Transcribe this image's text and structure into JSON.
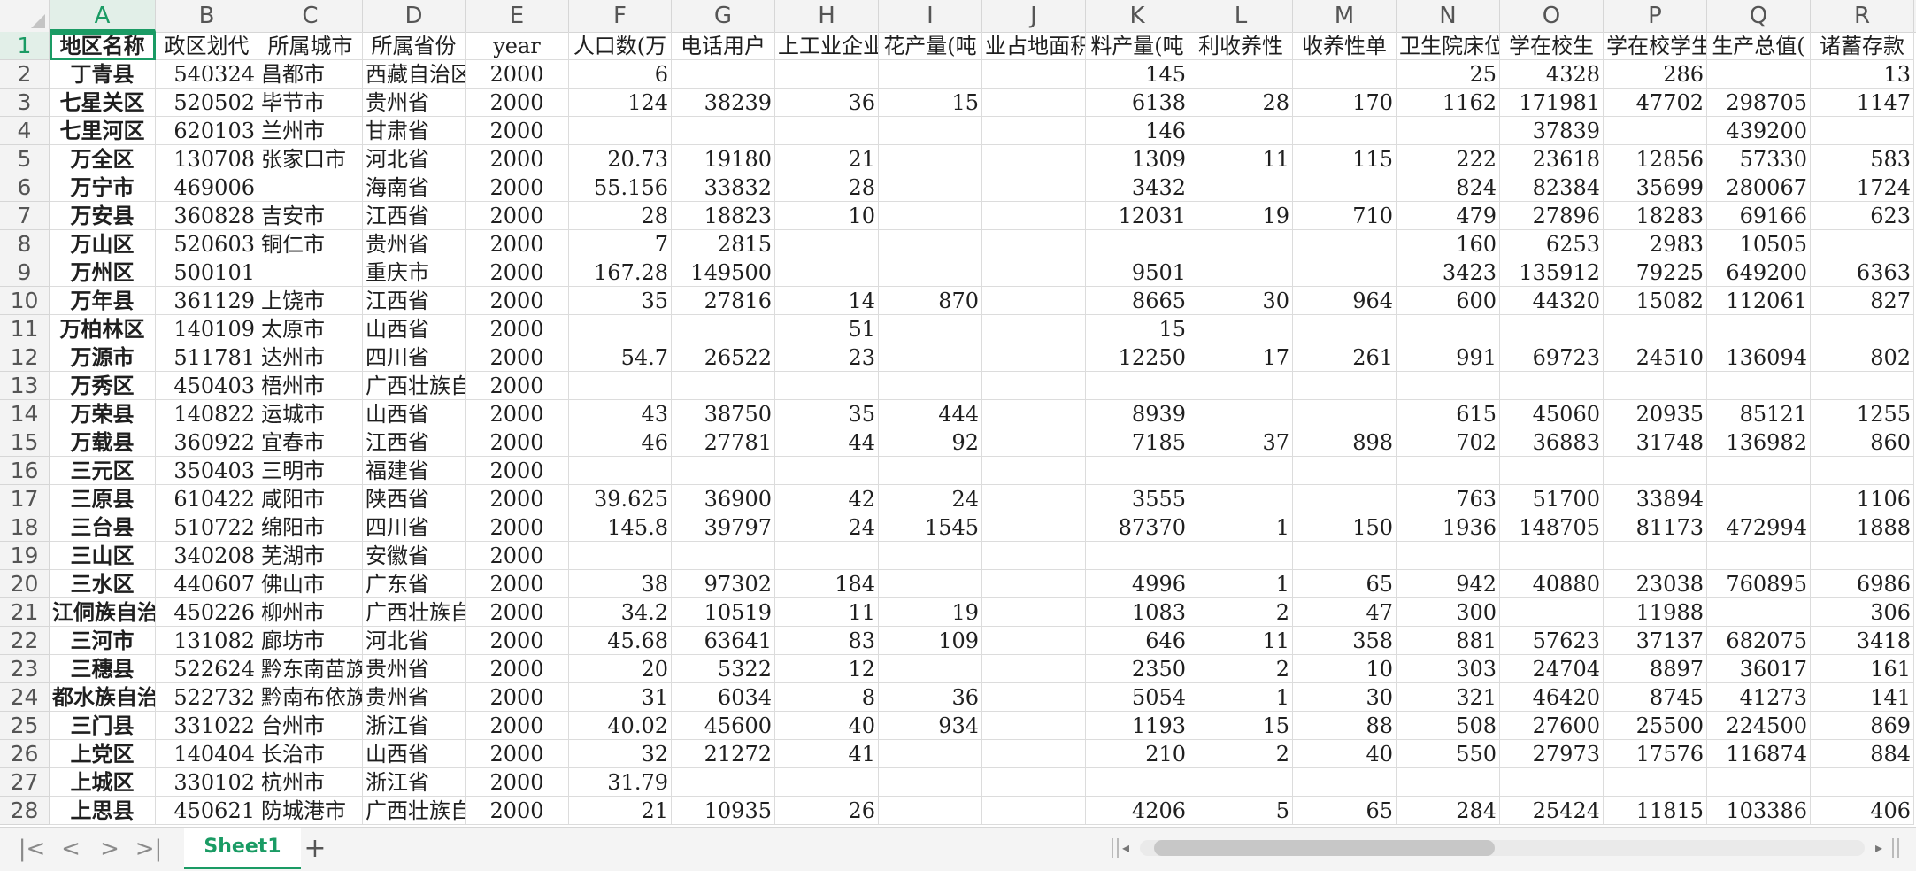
{
  "columns": [
    "A",
    "B",
    "C",
    "D",
    "E",
    "F",
    "G",
    "H",
    "I",
    "J",
    "K",
    "L",
    "M",
    "N",
    "O",
    "P",
    "Q",
    "R"
  ],
  "active_column": "A",
  "active_row": "1",
  "rows": [
    {
      "n": "1",
      "cells": [
        "地区名称",
        "政区划代",
        "所属城市",
        "所属省份",
        "year",
        "人口数(万",
        "电话用户",
        "上工业企业",
        "花产量(吨",
        "业占地面积",
        "料产量(吨",
        "利收养性",
        "收养性单",
        "卫生院床位",
        "学在校生",
        "学在校学生",
        "生产总值(",
        "诸蓄存款"
      ]
    },
    {
      "n": "2",
      "cells": [
        "丁青县",
        "540324",
        "昌都市",
        "西藏自治区",
        "2000",
        "6",
        "",
        "",
        "",
        "",
        "145",
        "",
        "",
        "25",
        "4328",
        "286",
        "",
        "13"
      ]
    },
    {
      "n": "3",
      "cells": [
        "七星关区",
        "520502",
        "毕节市",
        "贵州省",
        "2000",
        "124",
        "38239",
        "36",
        "15",
        "",
        "6138",
        "28",
        "170",
        "1162",
        "171981",
        "47702",
        "298705",
        "1147"
      ]
    },
    {
      "n": "4",
      "cells": [
        "七里河区",
        "620103",
        "兰州市",
        "甘肃省",
        "2000",
        "",
        "",
        "",
        "",
        "",
        "146",
        "",
        "",
        "",
        "37839",
        "",
        "439200",
        ""
      ]
    },
    {
      "n": "5",
      "cells": [
        "万全区",
        "130708",
        "张家口市",
        "河北省",
        "2000",
        "20.73",
        "19180",
        "21",
        "",
        "",
        "1309",
        "11",
        "115",
        "222",
        "23618",
        "12856",
        "57330",
        "583"
      ]
    },
    {
      "n": "6",
      "cells": [
        "万宁市",
        "469006",
        "",
        "海南省",
        "2000",
        "55.156",
        "33832",
        "28",
        "",
        "",
        "3432",
        "",
        "",
        "824",
        "82384",
        "35699",
        "280067",
        "1724"
      ]
    },
    {
      "n": "7",
      "cells": [
        "万安县",
        "360828",
        "吉安市",
        "江西省",
        "2000",
        "28",
        "18823",
        "10",
        "",
        "",
        "12031",
        "19",
        "710",
        "479",
        "27896",
        "18283",
        "69166",
        "623"
      ]
    },
    {
      "n": "8",
      "cells": [
        "万山区",
        "520603",
        "铜仁市",
        "贵州省",
        "2000",
        "7",
        "2815",
        "",
        "",
        "",
        "",
        "",
        "",
        "160",
        "6253",
        "2983",
        "10505",
        ""
      ]
    },
    {
      "n": "9",
      "cells": [
        "万州区",
        "500101",
        "",
        "重庆市",
        "2000",
        "167.28",
        "149500",
        "",
        "",
        "",
        "9501",
        "",
        "",
        "3423",
        "135912",
        "79225",
        "649200",
        "6363"
      ]
    },
    {
      "n": "10",
      "cells": [
        "万年县",
        "361129",
        "上饶市",
        "江西省",
        "2000",
        "35",
        "27816",
        "14",
        "870",
        "",
        "8665",
        "30",
        "964",
        "600",
        "44320",
        "15082",
        "112061",
        "827"
      ]
    },
    {
      "n": "11",
      "cells": [
        "万柏林区",
        "140109",
        "太原市",
        "山西省",
        "2000",
        "",
        "",
        "51",
        "",
        "",
        "15",
        "",
        "",
        "",
        "",
        "",
        "",
        ""
      ]
    },
    {
      "n": "12",
      "cells": [
        "万源市",
        "511781",
        "达州市",
        "四川省",
        "2000",
        "54.7",
        "26522",
        "23",
        "",
        "",
        "12250",
        "17",
        "261",
        "991",
        "69723",
        "24510",
        "136094",
        "802"
      ]
    },
    {
      "n": "13",
      "cells": [
        "万秀区",
        "450403",
        "梧州市",
        "广西壮族自",
        "2000",
        "",
        "",
        "",
        "",
        "",
        "",
        "",
        "",
        "",
        "",
        "",
        "",
        ""
      ]
    },
    {
      "n": "14",
      "cells": [
        "万荣县",
        "140822",
        "运城市",
        "山西省",
        "2000",
        "43",
        "38750",
        "35",
        "444",
        "",
        "8939",
        "",
        "",
        "615",
        "45060",
        "20935",
        "85121",
        "1255"
      ]
    },
    {
      "n": "15",
      "cells": [
        "万载县",
        "360922",
        "宜春市",
        "江西省",
        "2000",
        "46",
        "27781",
        "44",
        "92",
        "",
        "7185",
        "37",
        "898",
        "702",
        "36883",
        "31748",
        "136982",
        "860"
      ]
    },
    {
      "n": "16",
      "cells": [
        "三元区",
        "350403",
        "三明市",
        "福建省",
        "2000",
        "",
        "",
        "",
        "",
        "",
        "",
        "",
        "",
        "",
        "",
        "",
        "",
        ""
      ]
    },
    {
      "n": "17",
      "cells": [
        "三原县",
        "610422",
        "咸阳市",
        "陕西省",
        "2000",
        "39.625",
        "36900",
        "42",
        "24",
        "",
        "3555",
        "",
        "",
        "763",
        "51700",
        "33894",
        "",
        "1106"
      ]
    },
    {
      "n": "18",
      "cells": [
        "三台县",
        "510722",
        "绵阳市",
        "四川省",
        "2000",
        "145.8",
        "39797",
        "24",
        "1545",
        "",
        "87370",
        "1",
        "150",
        "1936",
        "148705",
        "81173",
        "472994",
        "1888"
      ]
    },
    {
      "n": "19",
      "cells": [
        "三山区",
        "340208",
        "芜湖市",
        "安徽省",
        "2000",
        "",
        "",
        "",
        "",
        "",
        "",
        "",
        "",
        "",
        "",
        "",
        "",
        ""
      ]
    },
    {
      "n": "20",
      "cells": [
        "三水区",
        "440607",
        "佛山市",
        "广东省",
        "2000",
        "38",
        "97302",
        "184",
        "",
        "",
        "4996",
        "1",
        "65",
        "942",
        "40880",
        "23038",
        "760895",
        "6986"
      ]
    },
    {
      "n": "21",
      "cells": [
        "江侗族自治",
        "450226",
        "柳州市",
        "广西壮族自",
        "2000",
        "34.2",
        "10519",
        "11",
        "19",
        "",
        "1083",
        "2",
        "47",
        "300",
        "",
        "11988",
        "",
        "306"
      ]
    },
    {
      "n": "22",
      "cells": [
        "三河市",
        "131082",
        "廊坊市",
        "河北省",
        "2000",
        "45.68",
        "63641",
        "83",
        "109",
        "",
        "646",
        "11",
        "358",
        "881",
        "57623",
        "37137",
        "682075",
        "3418"
      ]
    },
    {
      "n": "23",
      "cells": [
        "三穗县",
        "522624",
        "黔东南苗族",
        "贵州省",
        "2000",
        "20",
        "5322",
        "12",
        "",
        "",
        "2350",
        "2",
        "10",
        "303",
        "24704",
        "8897",
        "36017",
        "161"
      ]
    },
    {
      "n": "24",
      "cells": [
        "都水族自治",
        "522732",
        "黔南布依族",
        "贵州省",
        "2000",
        "31",
        "6034",
        "8",
        "36",
        "",
        "5054",
        "1",
        "30",
        "321",
        "46420",
        "8745",
        "41273",
        "141"
      ]
    },
    {
      "n": "25",
      "cells": [
        "三门县",
        "331022",
        "台州市",
        "浙江省",
        "2000",
        "40.02",
        "45600",
        "40",
        "934",
        "",
        "1193",
        "15",
        "88",
        "508",
        "27600",
        "25500",
        "224500",
        "869"
      ]
    },
    {
      "n": "26",
      "cells": [
        "上党区",
        "140404",
        "长治市",
        "山西省",
        "2000",
        "32",
        "21272",
        "41",
        "",
        "",
        "210",
        "2",
        "40",
        "550",
        "27973",
        "17576",
        "116874",
        "884"
      ]
    },
    {
      "n": "27",
      "cells": [
        "上城区",
        "330102",
        "杭州市",
        "浙江省",
        "2000",
        "31.79",
        "",
        "",
        "",
        "",
        "",
        "",
        "",
        "",
        "",
        "",
        "",
        ""
      ]
    },
    {
      "n": "28",
      "cells": [
        "上思县",
        "450621",
        "防城港市",
        "广西壮族自",
        "2000",
        "21",
        "10935",
        "26",
        "",
        "",
        "4206",
        "5",
        "65",
        "284",
        "25424",
        "11815",
        "103386",
        "406"
      ]
    }
  ],
  "tabbar": {
    "nav_first": "|<",
    "nav_prev": "<",
    "nav_next": ">",
    "nav_last": ">|",
    "sheet_name": "Sheet1",
    "add_sheet": "+",
    "scroll_left": "◂",
    "scroll_right": "▸"
  },
  "scroll_position": 0.02,
  "scroll_visible_fraction": 0.47,
  "accent_color": "#1a9b64"
}
